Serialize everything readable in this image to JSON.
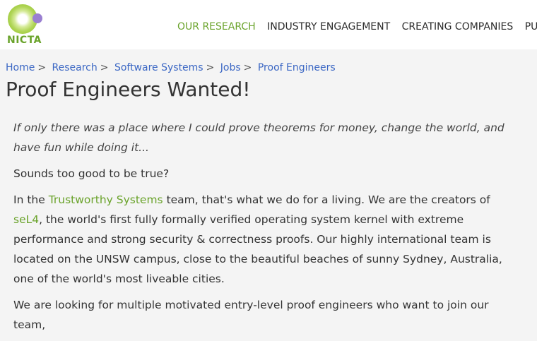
{
  "header": {
    "logo_text": "NICTA",
    "nav": [
      {
        "label": "OUR RESEARCH",
        "active": true
      },
      {
        "label": "INDUSTRY ENGAGEMENT",
        "active": false
      },
      {
        "label": "CREATING COMPANIES",
        "active": false
      },
      {
        "label": "PUBL",
        "active": false
      }
    ]
  },
  "breadcrumb": {
    "items": [
      "Home",
      "Research",
      "Software Systems",
      "Jobs",
      "Proof Engineers"
    ],
    "separator": ">"
  },
  "page": {
    "title": "Proof Engineers Wanted!"
  },
  "content": {
    "intro": "If only there was a place where I could prove theorems for money, change the world, and have fun while doing it...",
    "question": "Sounds too good to be true?",
    "para1_before": "In the ",
    "para1_link1": "Trustworthy Systems",
    "para1_mid": " team, that's what we do for a living. We are the creators of ",
    "para1_link2": "seL4",
    "para1_after": ", the world's first fully formally verified operating system kernel with extreme performance and strong security & correctness proofs. Our highly international team is located on the UNSW campus, close to the beautiful beaches of sunny Sydney, Australia, one of the world's most liveable cities.",
    "para2": "We are looking for multiple motivated entry-level proof engineers who want to join our team,"
  },
  "colors": {
    "accent_green": "#6aa32b",
    "link_blue": "#3b67c4",
    "logo_purple": "#9a7fd1",
    "background": "#f4f4f4"
  }
}
